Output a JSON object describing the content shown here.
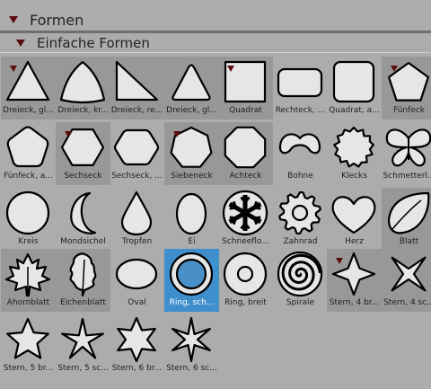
{
  "panel": {
    "title": "Formen",
    "subtitle": "Einfache Formen"
  },
  "shapes": [
    {
      "label": "Dreieck, gl...",
      "icon": "triangle-icon",
      "marked": true,
      "dark": true
    },
    {
      "label": "Dreieck, kr...",
      "icon": "curved-triangle-icon",
      "marked": false,
      "dark": true
    },
    {
      "label": "Dreieck, re...",
      "icon": "right-triangle-icon",
      "marked": false,
      "dark": true
    },
    {
      "label": "Dreieck, gl...",
      "icon": "rounded-triangle-icon",
      "marked": false,
      "dark": true
    },
    {
      "label": "Quadrat",
      "icon": "square-icon",
      "marked": true,
      "dark": true
    },
    {
      "label": "Rechteck, ...",
      "icon": "rounded-rectangle-icon",
      "marked": false,
      "dark": false
    },
    {
      "label": "Quadrat, a...",
      "icon": "rounded-square-icon",
      "marked": false,
      "dark": false
    },
    {
      "label": "Fünfeck",
      "icon": "pentagon-icon",
      "marked": true,
      "dark": true
    },
    {
      "label": "Fünfeck, a...",
      "icon": "rounded-pentagon-icon",
      "marked": false,
      "dark": false
    },
    {
      "label": "Sechseck",
      "icon": "hexagon-icon",
      "marked": true,
      "dark": true
    },
    {
      "label": "Sechseck, ...",
      "icon": "rounded-hexagon-icon",
      "marked": false,
      "dark": false
    },
    {
      "label": "Siebeneck",
      "icon": "heptagon-icon",
      "marked": true,
      "dark": true
    },
    {
      "label": "Achteck",
      "icon": "octagon-icon",
      "marked": false,
      "dark": true
    },
    {
      "label": "Bohne",
      "icon": "bean-icon",
      "marked": false,
      "dark": false
    },
    {
      "label": "Klecks",
      "icon": "splat-icon",
      "marked": false,
      "dark": false
    },
    {
      "label": "Schmetterl...",
      "icon": "butterfly-icon",
      "marked": false,
      "dark": false
    },
    {
      "label": "Kreis",
      "icon": "circle-icon",
      "marked": false,
      "dark": false
    },
    {
      "label": "Mondsichel",
      "icon": "crescent-icon",
      "marked": false,
      "dark": false
    },
    {
      "label": "Tropfen",
      "icon": "drop-icon",
      "marked": false,
      "dark": false
    },
    {
      "label": "Ei",
      "icon": "egg-icon",
      "marked": false,
      "dark": false
    },
    {
      "label": "Schneeflo...",
      "icon": "snowflake-icon",
      "marked": false,
      "dark": false
    },
    {
      "label": "Zahnrad",
      "icon": "gear-icon",
      "marked": false,
      "dark": false
    },
    {
      "label": "Herz",
      "icon": "heart-icon",
      "marked": false,
      "dark": false
    },
    {
      "label": "Blatt",
      "icon": "leaf-icon",
      "marked": false,
      "dark": true
    },
    {
      "label": "Ahornblatt",
      "icon": "maple-leaf-icon",
      "marked": false,
      "dark": true
    },
    {
      "label": "Eichenblatt",
      "icon": "oak-leaf-icon",
      "marked": false,
      "dark": true
    },
    {
      "label": "Oval",
      "icon": "oval-icon",
      "marked": false,
      "dark": false
    },
    {
      "label": "Ring, sch...",
      "icon": "thin-ring-icon",
      "marked": false,
      "dark": false,
      "selected": true
    },
    {
      "label": "Ring, breit",
      "icon": "wide-ring-icon",
      "marked": false,
      "dark": false
    },
    {
      "label": "Spirale",
      "icon": "spiral-icon",
      "marked": false,
      "dark": false
    },
    {
      "label": "Stern, 4 br...",
      "icon": "star-4-wide-icon",
      "marked": true,
      "dark": true
    },
    {
      "label": "Stern, 4 sc...",
      "icon": "star-4-narrow-icon",
      "marked": false,
      "dark": true
    },
    {
      "label": "Stern, 5 br...",
      "icon": "star-5-wide-icon",
      "marked": false,
      "dark": false
    },
    {
      "label": "Stern, 5 sc...",
      "icon": "star-5-narrow-icon",
      "marked": false,
      "dark": false
    },
    {
      "label": "Stern, 6 br...",
      "icon": "star-6-wide-icon",
      "marked": false,
      "dark": false
    },
    {
      "label": "Stern, 6 sc...",
      "icon": "star-6-narrow-icon",
      "marked": false,
      "dark": false
    }
  ]
}
